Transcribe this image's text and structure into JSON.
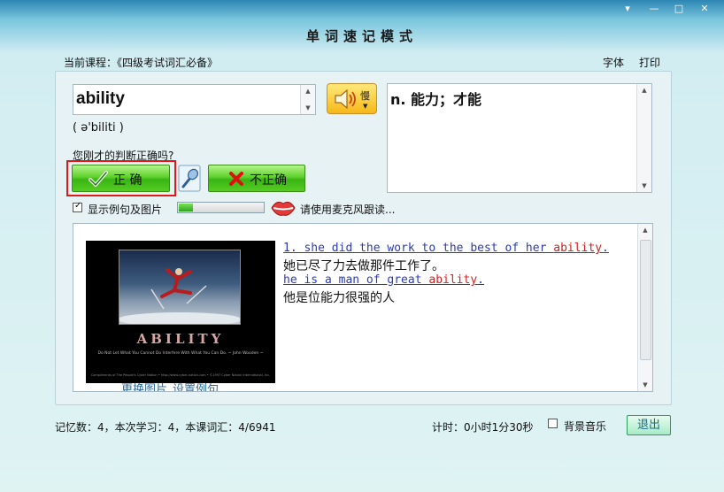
{
  "window": {
    "title": "单词速记模式",
    "controls": [
      "▾",
      "—",
      "□",
      "✕"
    ]
  },
  "header": {
    "course_label": "当前课程：《四级考试词汇必备》",
    "font_link": "字体",
    "print_link": "打印"
  },
  "word": {
    "text": "ability",
    "phonetic": "( ə'biliti )",
    "meaning": "n. 能力；才能",
    "slow_label": "慢"
  },
  "judgement": {
    "question": "您刚才的判断正确吗?",
    "correct_label": "正 确",
    "incorrect_label": "不正确"
  },
  "options": {
    "show_examples_label": "显示例句及图片",
    "show_examples_checked": true,
    "recording_level": 0.17,
    "mic_prompt": "请使用麦克风跟读..."
  },
  "examples": {
    "items": [
      {
        "en_prefix": "1. she did the work to the best of her ",
        "en_highlight": "ability",
        "en_suffix": ".",
        "cn": "她已尽了力去做那件工作了。"
      },
      {
        "en_prefix": "he is a man of great ",
        "en_highlight": "ability",
        "en_suffix": ".",
        "cn": "他是位能力很强的人"
      }
    ],
    "image_caption": "ABILITY",
    "image_quote": "Do Not Let What You Cannot Do Interfere With What You Can Do. ~ John Wooden ~",
    "image_credit": "Compliments of The People's Cyber Nation • http://www.cyber-nation.com • ©1997 Cyber Nation International, Inc.",
    "change_image_link": "更换图片",
    "set_example_link": "设置例句"
  },
  "footer": {
    "stats": "记忆数：4，本次学习：4，本课词汇：4/6941",
    "timer": "计时：0小时1分30秒",
    "bg_music_label": "背景音乐",
    "bg_music_checked": false,
    "exit_label": "退出"
  },
  "colors": {
    "accent_green": "#38b514",
    "highlight_red": "#d22020",
    "example_blue": "#2b3bb7",
    "selection_frame": "#e01a1a"
  },
  "icons": [
    "dropdown-icon",
    "minimize-icon",
    "maximize-icon",
    "close-icon",
    "speaker-icon",
    "checkmark-icon",
    "cross-icon",
    "microphone-icon",
    "lips-icon",
    "checkbox-check-icon"
  ]
}
